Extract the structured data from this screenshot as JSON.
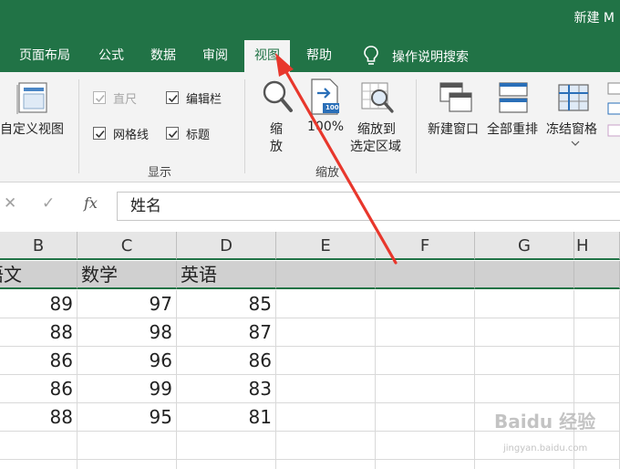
{
  "window": {
    "title": "新建 M"
  },
  "tabs": [
    {
      "label": "页面布局"
    },
    {
      "label": "公式"
    },
    {
      "label": "数据"
    },
    {
      "label": "审阅"
    },
    {
      "label": "视图",
      "active": true
    },
    {
      "label": "帮助"
    }
  ],
  "tell_me": {
    "label": "操作说明搜索",
    "icon": "lightbulb-icon"
  },
  "ribbon": {
    "workbook_views": {
      "custom_views_label": "自定义视图"
    },
    "show": {
      "group_label": "显示",
      "ruler": {
        "label": "直尺",
        "checked": true,
        "disabled": true
      },
      "formula_bar": {
        "label": "编辑栏",
        "checked": true
      },
      "gridlines": {
        "label": "网格线",
        "checked": true
      },
      "headings": {
        "label": "标题",
        "checked": true
      }
    },
    "zoom": {
      "group_label": "缩放",
      "zoom_label_1": "缩",
      "zoom_label_2": "放",
      "hundred_label": "100%",
      "hundred_icon_text": "100",
      "selection_label_1": "缩放到",
      "selection_label_2": "选定区域"
    },
    "window": {
      "new_window_label": "新建窗口",
      "arrange_all_label": "全部重排",
      "freeze_panes_label": "冻结窗格"
    }
  },
  "formula_bar": {
    "cancel_symbol": "✕",
    "enter_symbol": "✓",
    "fx_label": "fx",
    "value": "姓名"
  },
  "sheet": {
    "columns": [
      "B",
      "C",
      "D",
      "E",
      "F",
      "G",
      "H"
    ],
    "header_row": [
      "语文",
      "数学",
      "英语"
    ],
    "rows": [
      [
        "89",
        "97",
        "85"
      ],
      [
        "88",
        "98",
        "87"
      ],
      [
        "86",
        "96",
        "86"
      ],
      [
        "86",
        "99",
        "83"
      ],
      [
        "88",
        "95",
        "81"
      ]
    ]
  },
  "watermark": {
    "text": "Baidu 经验",
    "url_text": "jingyan.baidu.com"
  },
  "colors": {
    "accent": "#217346",
    "arrow": "#e8372c"
  }
}
